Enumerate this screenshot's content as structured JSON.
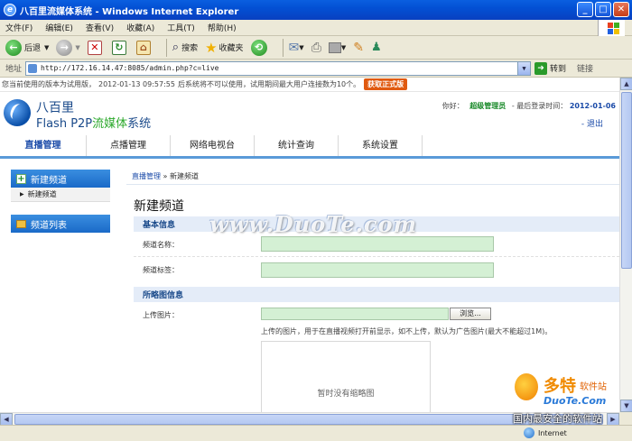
{
  "window": {
    "title": "八百里流媒体系统 - Windows Internet Explorer"
  },
  "menu": [
    "文件(F)",
    "编辑(E)",
    "查看(V)",
    "收藏(A)",
    "工具(T)",
    "帮助(H)"
  ],
  "toolbar": {
    "back": "后退",
    "search": "搜索",
    "favorites": "收藏夹"
  },
  "address": {
    "label": "地址",
    "url": "http://172.16.14.47:8085/admin.php?c=live",
    "go": "转到",
    "links": "链接"
  },
  "status": {
    "zone": "Internet"
  },
  "notice": {
    "text1": "您当前使用的版本为试用版，",
    "time": "2012-01-13 09:57:55",
    "text2": "后系统将不可以使用，试用期间最大用户连接数为10个。",
    "buy": "获取正式版"
  },
  "header": {
    "logo_cn": "八百里",
    "logo_en_1": "Flash P2P",
    "logo_en_2": "流媒体",
    "logo_en_3": "系统",
    "greeting": "你好：",
    "username": "超级管理员",
    "last_login_label": "- 最后登录时间：",
    "last_login_date": "2012-01-06",
    "logout": "退出"
  },
  "nav": [
    "直播管理",
    "点播管理",
    "网络电视台",
    "统计查询",
    "系统设置"
  ],
  "sidebar": {
    "new_channel": "新建频道",
    "new_channel_sub": "新建频道",
    "channel_list": "频道列表"
  },
  "breadcrumb": {
    "root": "直播管理",
    "sep": "»",
    "current": "新建频道"
  },
  "form": {
    "title": "新建频道",
    "section_basic": "基本信息",
    "name_label": "频道名称：",
    "tag_label": "频道标签：",
    "section_thumb": "所略图信息",
    "upload_label": "上传图片：",
    "browse": "浏览...",
    "hint": "上传的图片，用于在直播视频打开前显示，如不上传，默认为广告图片(最大不能超过1M)。",
    "no_thumb": "暂时没有缩略图"
  },
  "watermark": {
    "site": "www.DuoTe.com",
    "brand_1": "多特",
    "brand_2": "软件站",
    "brand_3": "DuoTe.Com",
    "brand_4": "国内最安全的软件站"
  }
}
